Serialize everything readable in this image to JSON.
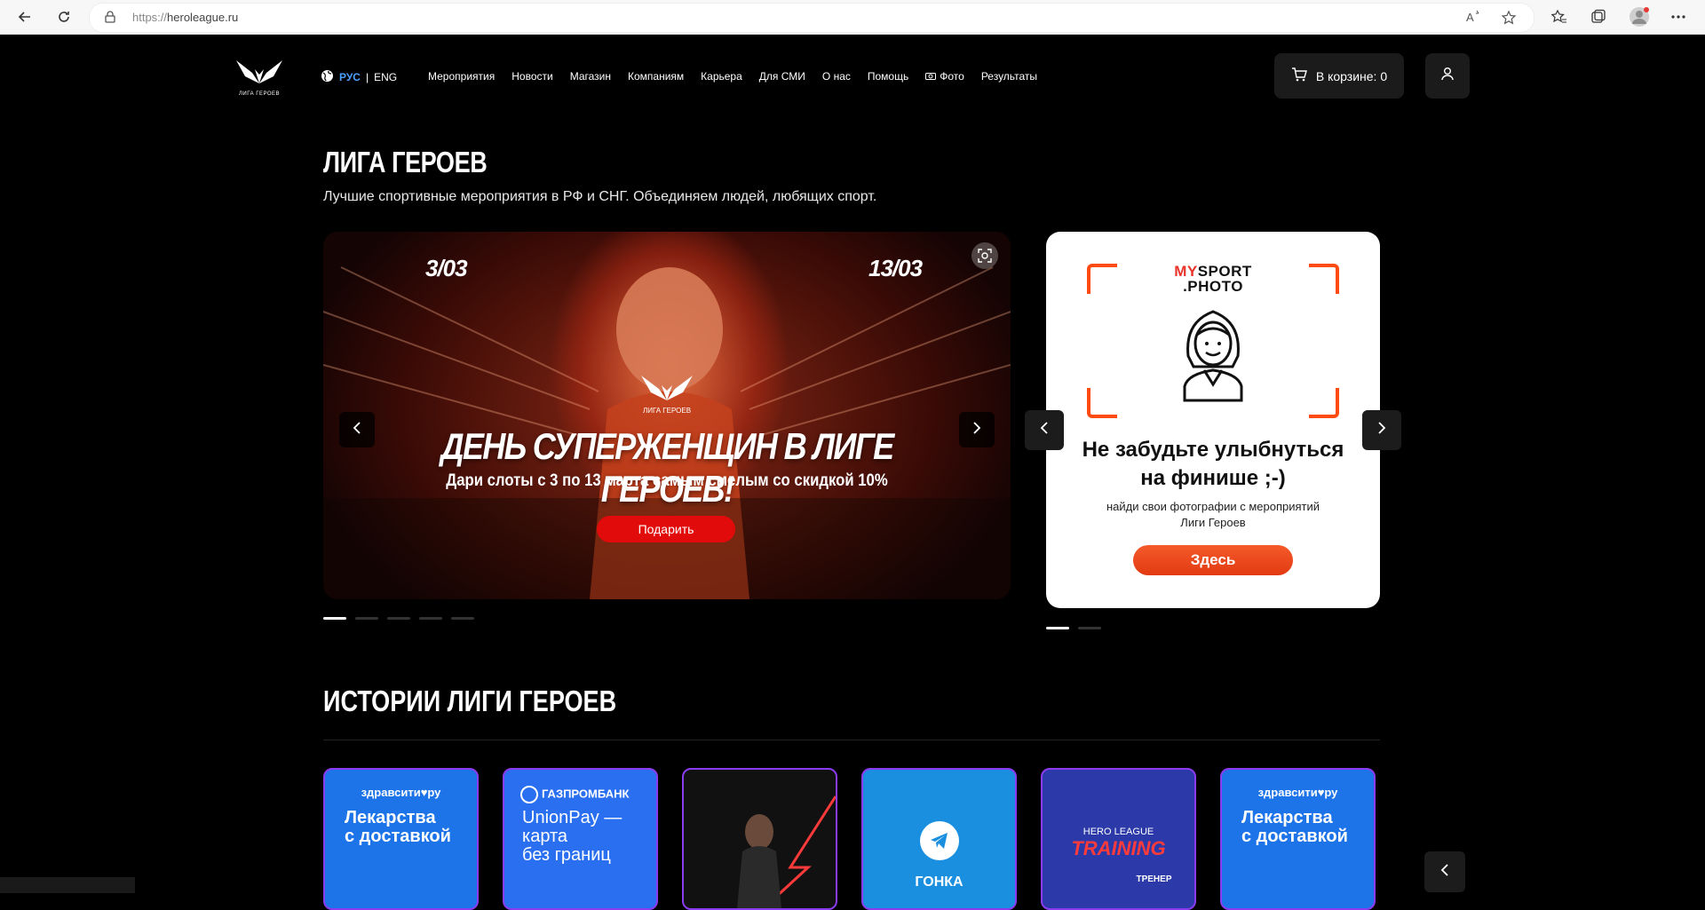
{
  "browser": {
    "url_scheme": "https://",
    "url_host": "heroleague.ru"
  },
  "header": {
    "logo_text": "ЛИГА ГЕРОЕВ",
    "lang_active": "РУС",
    "lang_separator": "|",
    "lang_other": "ENG",
    "nav": [
      {
        "label": "Мероприятия"
      },
      {
        "label": "Новости"
      },
      {
        "label": "Магазин"
      },
      {
        "label": "Компаниям"
      },
      {
        "label": "Карьера"
      },
      {
        "label": "Для СМИ"
      },
      {
        "label": "О нас"
      },
      {
        "label": "Помощь"
      },
      {
        "label": "Фото"
      },
      {
        "label": "Результаты"
      }
    ],
    "cart_label": "В корзине: 0"
  },
  "hero": {
    "title": "ЛИГА ГЕРОЕВ",
    "subtitle": "Лучшие спортивные мероприятия в РФ и СНГ. Объединяем людей, любящих спорт.",
    "banner": {
      "date_start": "3/03",
      "date_end": "13/03",
      "logo_caption": "ЛИГА ГЕРОЕВ",
      "headline": "ДЕНЬ СУПЕРЖЕНЩИН В ЛИГЕ ГЕРОЕВ!",
      "subline": "Дари слоты с 3 по 13 марта самым смелым со скидкой 10%",
      "cta": "Подарить",
      "slide_count": 5,
      "active_slide": 1
    },
    "photo_card": {
      "brand_my": "MY",
      "brand_sport": "SPORT",
      "brand_photo": ".PHOTO",
      "title_line1": "Не забудьте улыбнуться",
      "title_line2": "на финише ;-)",
      "desc_line1": "найди свои фотографии с мероприятий",
      "desc_line2": "Лиги Героев",
      "cta": "Здесь",
      "slide_count": 2,
      "active_slide": 1
    }
  },
  "stories": {
    "title": "ИСТОРИИ ЛИГИ ГЕРОЕВ",
    "items": [
      {
        "brand": "здравсити♥ру",
        "text_line1": "Лекарства",
        "text_line2": "с доставкой",
        "bg": "#1d73e8"
      },
      {
        "brand": "ГАЗПРОМБАНК",
        "text_line1": "UnionPay —",
        "text_line2": "карта",
        "text_line3": "без границ",
        "bg": "#2a6ff0"
      },
      {
        "brand": "",
        "bg": "#111111"
      },
      {
        "brand": "",
        "text_line1": "ГОНКА",
        "bg": "#1a8fe0"
      },
      {
        "brand": "HERO LEAGUE",
        "text_line1": "TRAINING",
        "text_line2": "ТРЕНЕР",
        "bg": "#2b3aa8"
      },
      {
        "brand": "здравсити♥ру",
        "text_line1": "Лекарства",
        "text_line2": "с доставкой",
        "bg": "#1d73e8"
      }
    ]
  },
  "colors": {
    "accent_blue": "#4a9fff",
    "cta_red": "#e20b0b",
    "mysport_orange": "#ff4a12",
    "story_border": "#8b3cf0"
  }
}
